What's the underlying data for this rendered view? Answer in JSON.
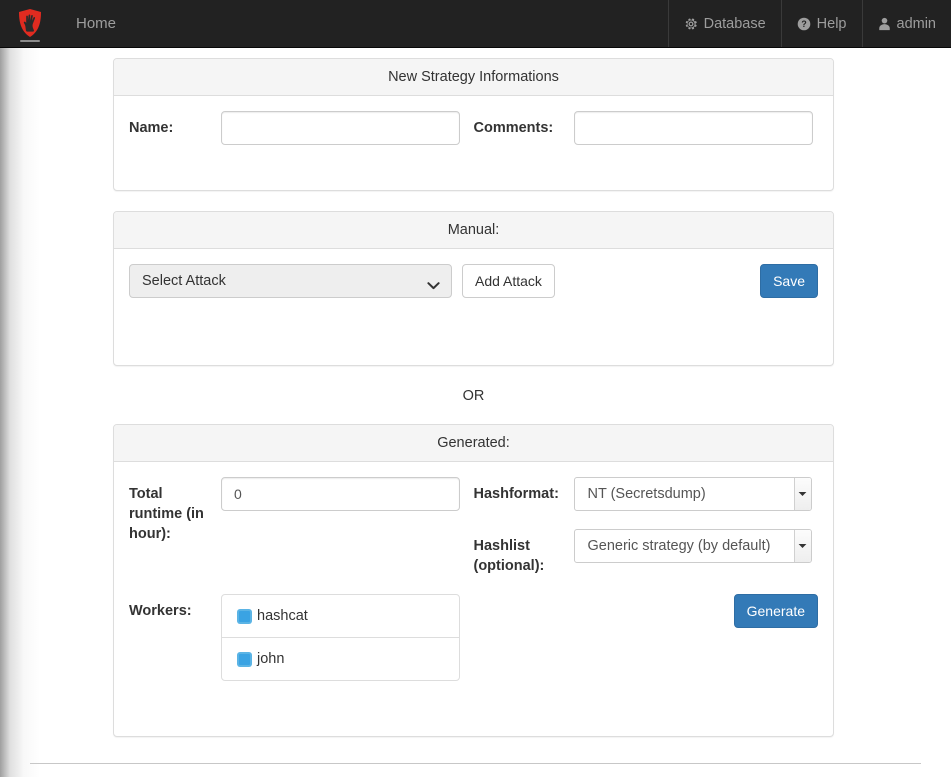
{
  "navbar": {
    "brand_icon": "shield-logo-icon",
    "home_label": "Home",
    "right_items": [
      {
        "label": "Database",
        "icon": "gear-icon"
      },
      {
        "label": "Help",
        "icon": "question-circle-icon"
      },
      {
        "label": "admin",
        "icon": "user-icon"
      }
    ]
  },
  "strategy_panel": {
    "title": "New Strategy Informations",
    "name_label": "Name:",
    "name_value": "",
    "name_placeholder": "",
    "comments_label": "Comments:",
    "comments_value": "",
    "comments_placeholder": ""
  },
  "manual_panel": {
    "title": "Manual:",
    "select_attack_value": "Select Attack",
    "select_attack_options": [
      "Select Attack"
    ],
    "add_attack_label": "Add Attack",
    "save_label": "Save"
  },
  "divider": {
    "or_label": "OR"
  },
  "generated_panel": {
    "title": "Generated:",
    "runtime_label": "Total runtime (in hour):",
    "runtime_value": "0",
    "hashformat_label": "Hashformat:",
    "hashformat_value": "NT (Secretsdump)",
    "hashlist_label": "Hashlist (optional):",
    "hashlist_value": "Generic strategy (by default)",
    "workers_label": "Workers:",
    "workers": [
      {
        "name": "hashcat",
        "checked": true
      },
      {
        "name": "john",
        "checked": true
      }
    ],
    "generate_label": "Generate"
  },
  "colors": {
    "navbar_bg": "#222222",
    "primary": "#337ab7",
    "panel_heading_bg": "#f5f5f5",
    "border": "#dddddd",
    "checkbox_blue": "#5bb4e5",
    "logo_red": "#e02b20"
  }
}
